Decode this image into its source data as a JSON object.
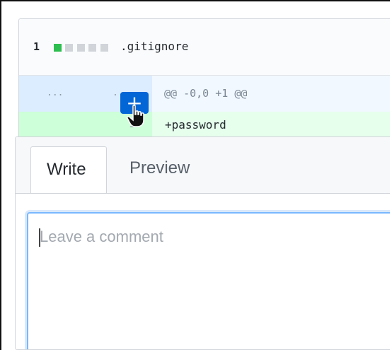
{
  "diff": {
    "file": {
      "change_count": "1",
      "name": ".gitignore",
      "diffstat": [
        "added",
        "neutral",
        "neutral",
        "neutral",
        "neutral"
      ]
    },
    "hunk": {
      "old_dots": "...",
      "new_dots": "...",
      "header": "@@ -0,0 +1 @@"
    },
    "added_line": {
      "line_number": "1",
      "code": "+password"
    },
    "add_comment_button": "+"
  },
  "comment": {
    "tabs": [
      {
        "label": "Write",
        "active": true
      },
      {
        "label": "Preview",
        "active": false
      }
    ],
    "placeholder": "Leave a comment"
  },
  "colors": {
    "accent": "#0366d6",
    "added_bg": "#e6ffed",
    "hunk_bg": "#f1f8ff"
  },
  "icons": [
    "plus-icon",
    "hand-cursor-icon"
  ]
}
